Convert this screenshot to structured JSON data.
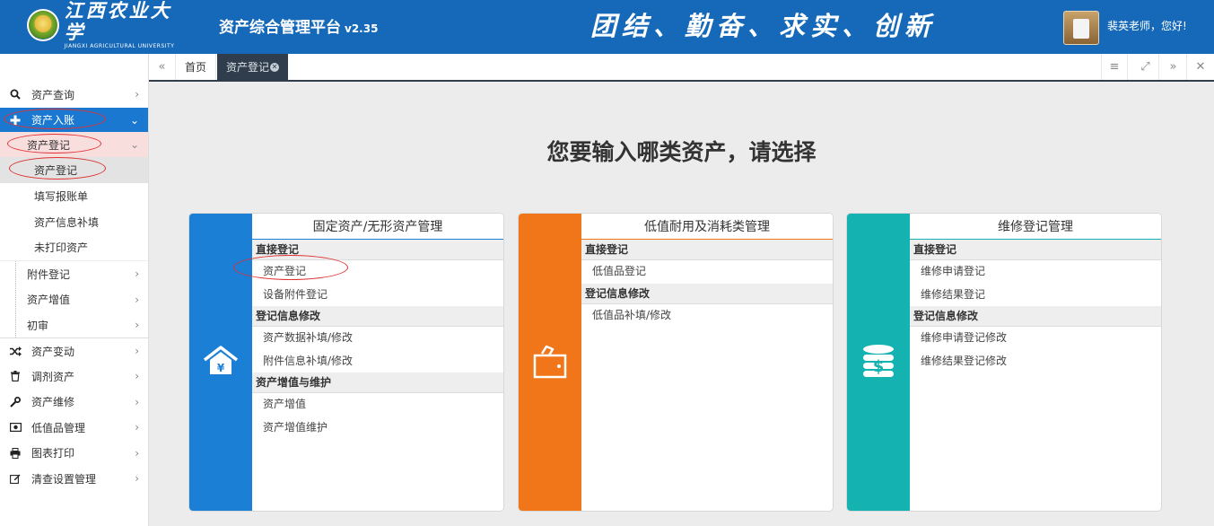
{
  "header": {
    "logo_cn": "江西农业大学",
    "logo_en": "JIANGXI AGRICULTURAL UNIVERSITY",
    "app_title": "资产综合管理平台",
    "app_version": "v2.35",
    "slogan": "团结、勤奋、求实、创新",
    "greeting": "裴英老师，您好!"
  },
  "sidebar": {
    "items": [
      {
        "label": "资产查询",
        "icon": "search-icon"
      },
      {
        "label": "资产入账",
        "icon": "plus-icon",
        "active": true
      },
      {
        "label": "资产登记",
        "expanded": true
      },
      {
        "label": "资产登记",
        "selected": true
      },
      {
        "label": "填写报账单"
      },
      {
        "label": "资产信息补填"
      },
      {
        "label": "未打印资产"
      },
      {
        "label": "附件登记"
      },
      {
        "label": "资产增值"
      },
      {
        "label": "初审"
      },
      {
        "label": "资产变动",
        "icon": "shuffle-icon"
      },
      {
        "label": "调剂资产",
        "icon": "trash-icon"
      },
      {
        "label": "资产维修",
        "icon": "wrench-icon"
      },
      {
        "label": "低值品管理",
        "icon": "money-icon"
      },
      {
        "label": "图表打印",
        "icon": "print-icon"
      },
      {
        "label": "清查设置管理",
        "icon": "edit-icon"
      }
    ]
  },
  "tabs": {
    "home": "首页",
    "active": "资产登记"
  },
  "main": {
    "question": "您要输入哪类资产，请选择",
    "cards": [
      {
        "title": "固定资产/无形资产管理",
        "color": "#1b7fd6",
        "icon": "house-yuan-icon",
        "sections": [
          {
            "title": "直接登记",
            "items": [
              "资产登记",
              "设备附件登记"
            ]
          },
          {
            "title": "登记信息修改",
            "items": [
              "资产数据补填/修改",
              "附件信息补填/修改"
            ]
          },
          {
            "title": "资产增值与维护",
            "items": [
              "资产增值",
              "资产增值维护"
            ]
          }
        ]
      },
      {
        "title": "低值耐用及消耗类管理",
        "color": "#f07619",
        "icon": "wallet-icon",
        "sections": [
          {
            "title": "直接登记",
            "items": [
              "低值品登记"
            ]
          },
          {
            "title": "登记信息修改",
            "items": [
              "低值品补填/修改"
            ]
          }
        ]
      },
      {
        "title": "维修登记管理",
        "color": "#14b2b0",
        "icon": "coins-dollar-icon",
        "sections": [
          {
            "title": "直接登记",
            "items": [
              "维修申请登记",
              "维修结果登记"
            ]
          },
          {
            "title": "登记信息修改",
            "items": [
              "维修申请登记修改",
              "维修结果登记修改"
            ]
          }
        ]
      }
    ]
  }
}
